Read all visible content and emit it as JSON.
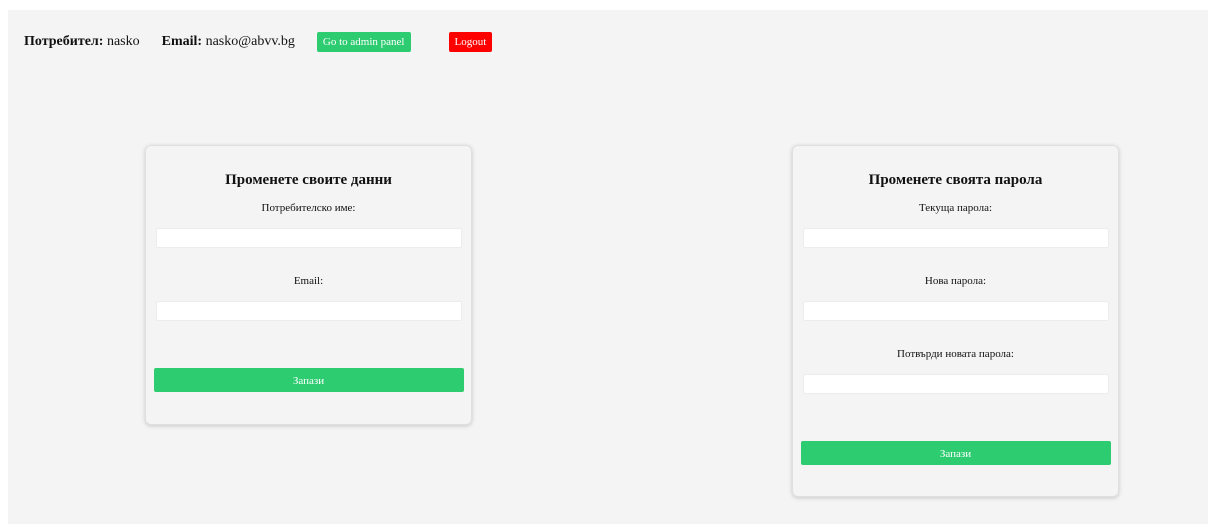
{
  "header": {
    "user_label": "Потребител:",
    "user_value": "nasko",
    "email_label": "Email:",
    "email_value": "nasko@abvv.bg",
    "admin_button": "Go to admin panel",
    "logout_button": "Logout"
  },
  "profile_form": {
    "title": "Променете своите данни",
    "username_label": "Потребителско име:",
    "username_value": "",
    "email_label": "Email:",
    "email_value": "",
    "save_label": "Запази"
  },
  "password_form": {
    "title": "Променете своята парола",
    "current_label": "Текуща парола:",
    "new_label": "Нова парола:",
    "confirm_label": "Потвърди новата парола:",
    "save_label": "Запази"
  },
  "colors": {
    "accent_green": "#2ecc71",
    "logout_red": "#ff0000",
    "background": "#f4f4f4"
  }
}
